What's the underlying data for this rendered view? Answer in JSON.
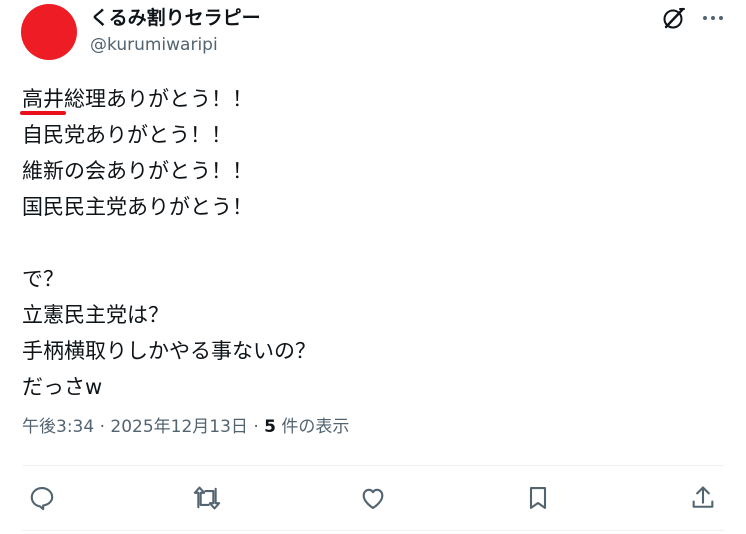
{
  "author": {
    "display_name": "くるみ割りセラピー",
    "handle": "@kurumiwaripi",
    "avatar_color": "#ee1c25"
  },
  "tweet": {
    "underlined_prefix": "高井",
    "first_line_rest": "総理ありがとう！！",
    "lines": [
      "自民党ありがとう！！",
      "維新の会ありがとう！！",
      "国民民主党ありがとう！",
      "",
      "で？",
      "立憲民主党は？",
      "手柄横取りしかやる事ないの？",
      "だっさw"
    ],
    "underline_color": "#e8111b"
  },
  "meta": {
    "time": "午後3:34",
    "sep1": " · ",
    "date": "2025年12月13日",
    "sep2": " · ",
    "views_count": "5",
    "views_label": " 件の表示"
  },
  "icons": {
    "header": [
      "grok-icon",
      "more-icon"
    ],
    "actions": [
      "reply-icon",
      "retweet-icon",
      "like-icon",
      "bookmark-icon",
      "share-icon"
    ]
  },
  "colors": {
    "text": "#0f1419",
    "secondary": "#536471",
    "divider": "#eff3f4"
  }
}
